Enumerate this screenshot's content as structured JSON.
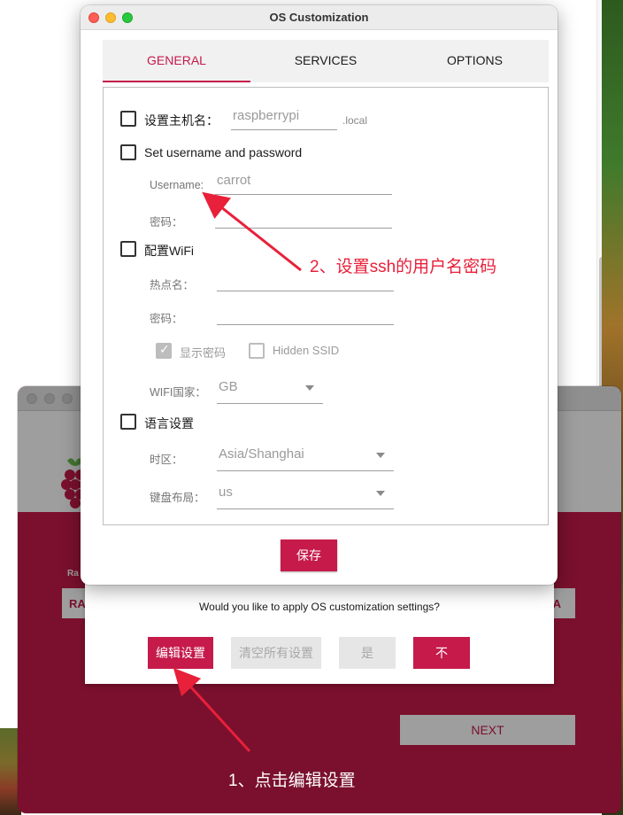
{
  "oc_window": {
    "title": "OS Customization",
    "tabs": [
      {
        "label": "GENERAL",
        "active": true
      },
      {
        "label": "SERVICES",
        "active": false
      },
      {
        "label": "OPTIONS",
        "active": false
      }
    ],
    "hostname": {
      "label": "设置主机名：",
      "value": "raspberrypi",
      "suffix": ".local",
      "checked": false
    },
    "credentials": {
      "label": "Set username and password",
      "checked": false,
      "username_label": "Username:",
      "username_value": "carrot",
      "password_label": "密码："
    },
    "wifi": {
      "label": "配置WiFi",
      "checked": false,
      "ssid_label": "热点名：",
      "password_label": "密码：",
      "show_password_label": "显示密码",
      "show_password_checked": true,
      "hidden_ssid_label": "Hidden SSID",
      "hidden_ssid_checked": false,
      "country_label": "WIFI国家：",
      "country_value": "GB"
    },
    "locale": {
      "label": "语言设置",
      "checked": false,
      "timezone_label": "时区：",
      "timezone_value": "Asia/Shanghai",
      "keyboard_label": "键盘布局：",
      "keyboard_value": "us"
    },
    "save_label": "保存"
  },
  "apply_dialog": {
    "question": "Would you like to apply OS customization settings?",
    "edit_label": "编辑设置",
    "clear_label": "清空所有设置",
    "yes_label": "是",
    "no_label": "不"
  },
  "imager": {
    "left_button_fragment": "RA",
    "left_label_fragment": "Ra",
    "right_button_fragment": "IA",
    "next_label": "NEXT"
  },
  "annotations": {
    "step1": "1、点击编辑设置",
    "step2": "2、设置ssh的用户名密码"
  },
  "colors": {
    "accent": "#c51a4a",
    "annotation": "#e8203a"
  }
}
